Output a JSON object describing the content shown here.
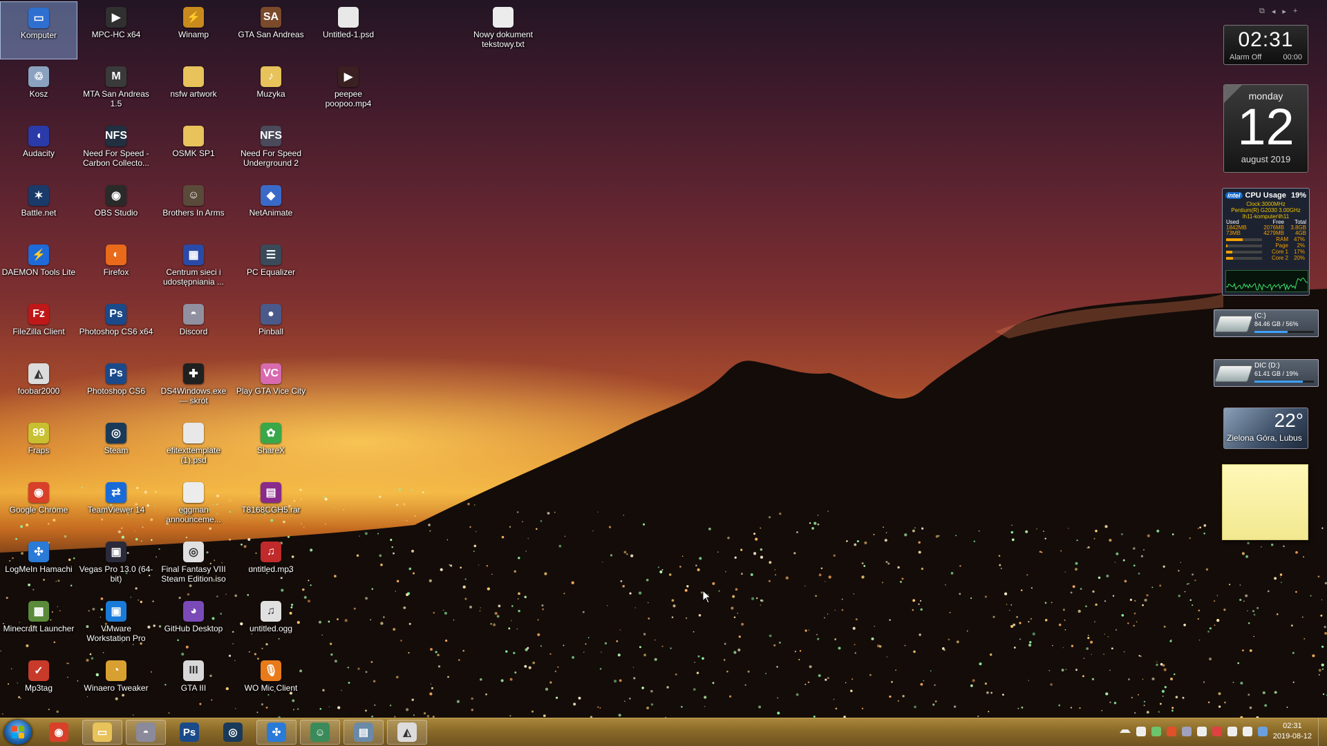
{
  "desktop": {
    "icons": [
      {
        "label": "Komputer",
        "icon": "computer-icon",
        "color": "#2f6fd0",
        "glyph": "▭"
      },
      {
        "label": "MPC-HC x64",
        "icon": "film-clapper-icon",
        "color": "#303030",
        "glyph": "▶"
      },
      {
        "label": "Winamp",
        "icon": "winamp-icon",
        "color": "#c88a1c",
        "glyph": "⚡"
      },
      {
        "label": "GTA San Andreas",
        "icon": "gta-sa-icon",
        "color": "#7a4a2a",
        "glyph": "SA"
      },
      {
        "label": "Untitled-1.psd",
        "icon": "file-icon",
        "color": "#e8e8e8",
        "glyph": ""
      },
      {
        "label": "Nowy dokument tekstowy.txt",
        "icon": "text-file-icon",
        "color": "#ececec",
        "glyph": ""
      },
      {
        "label": "Kosz",
        "icon": "recycle-bin-icon",
        "color": "#8aa2c0",
        "glyph": "♲"
      },
      {
        "label": "MTA San Andreas 1.5",
        "icon": "mta-icon",
        "color": "#3a3a3a",
        "glyph": "M"
      },
      {
        "label": "nsfw artwork",
        "icon": "folder-icon",
        "color": "#e8c25a",
        "glyph": ""
      },
      {
        "label": "Muzyka",
        "icon": "music-folder-icon",
        "color": "#e8c25a",
        "glyph": "♪"
      },
      {
        "label": "peepee poopoo.mp4",
        "icon": "video-file-icon",
        "color": "#3a2020",
        "glyph": "▶"
      },
      {
        "label": "Audacity",
        "icon": "audacity-icon",
        "color": "#2a3aa8",
        "glyph": "◖"
      },
      {
        "label": "Need For Speed - Carbon Collecto...",
        "icon": "nfs-carbon-icon",
        "color": "#203040",
        "glyph": "NFS"
      },
      {
        "label": "OSMK SP1",
        "icon": "folder-icon",
        "color": "#e8c25a",
        "glyph": ""
      },
      {
        "label": "Need For Speed Underground 2",
        "icon": "nfs-ug2-icon",
        "color": "#4a4a5a",
        "glyph": "NFS"
      },
      {
        "label": "Battle.net",
        "icon": "battlenet-icon",
        "color": "#1a3a6a",
        "glyph": "✶"
      },
      {
        "label": "OBS Studio",
        "icon": "obs-icon",
        "color": "#2a2a2a",
        "glyph": "◉"
      },
      {
        "label": "Brothers In Arms",
        "icon": "brothers-in-arms-icon",
        "color": "#5a4a3a",
        "glyph": "☺"
      },
      {
        "label": "NetAnimate",
        "icon": "netanimate-icon",
        "color": "#3a6ac8",
        "glyph": "◆"
      },
      {
        "label": "DAEMON Tools Lite",
        "icon": "daemon-tools-icon",
        "color": "#1e6ad8",
        "glyph": "⚡"
      },
      {
        "label": "Firefox",
        "icon": "firefox-icon",
        "color": "#e86a1a",
        "glyph": "◐"
      },
      {
        "label": "Centrum sieci i udostępniania ...",
        "icon": "network-center-icon",
        "color": "#2a4aa8",
        "glyph": "▦"
      },
      {
        "label": "PC Equalizer",
        "icon": "equalizer-icon",
        "color": "#3a4a5a",
        "glyph": "☰"
      },
      {
        "label": "FileZilla Client",
        "icon": "filezilla-icon",
        "color": "#c01818",
        "glyph": "Fz"
      },
      {
        "label": "Photoshop CS6 x64",
        "icon": "photoshop-icon",
        "color": "#1a4a8a",
        "glyph": "Ps"
      },
      {
        "label": "Discord",
        "icon": "discord-icon",
        "color": "#9090a0",
        "glyph": "◓"
      },
      {
        "label": "Pinball",
        "icon": "pinball-icon",
        "color": "#4a5a8a",
        "glyph": "●"
      },
      {
        "label": "foobar2000",
        "icon": "foobar-icon",
        "color": "#dcdcdc",
        "glyph": "◭"
      },
      {
        "label": "Photoshop CS6",
        "icon": "photoshop-icon",
        "color": "#1a4a8a",
        "glyph": "Ps"
      },
      {
        "label": "DS4Windows.exe — skrót",
        "icon": "gamepad-icon",
        "color": "#202020",
        "glyph": "✚"
      },
      {
        "label": "Play GTA Vice City",
        "icon": "gta-vc-icon",
        "color": "#d86ab0",
        "glyph": "VC"
      },
      {
        "label": "Fraps",
        "icon": "fraps-icon",
        "color": "#c8c030",
        "glyph": "99"
      },
      {
        "label": "Steam",
        "icon": "steam-icon",
        "color": "#1a3a5a",
        "glyph": "◎"
      },
      {
        "label": "efitexttemplate (1).psd",
        "icon": "file-icon",
        "color": "#e8e8e8",
        "glyph": ""
      },
      {
        "label": "ShareX",
        "icon": "sharex-icon",
        "color": "#38a848",
        "glyph": "✿"
      },
      {
        "label": "Google Chrome",
        "icon": "chrome-icon",
        "color": "#d8402a",
        "glyph": "◉"
      },
      {
        "label": "TeamViewer 14",
        "icon": "teamviewer-icon",
        "color": "#1a6ad8",
        "glyph": "⇄"
      },
      {
        "label": "eggman announceme...",
        "icon": "text-file-icon",
        "color": "#ececec",
        "glyph": ""
      },
      {
        "label": "T8168CGH5.rar",
        "icon": "rar-archive-icon",
        "color": "#8a2a8a",
        "glyph": "▤"
      },
      {
        "label": "LogMeIn Hamachi",
        "icon": "hamachi-icon",
        "color": "#2a7ad8",
        "glyph": "✣"
      },
      {
        "label": "Vegas Pro 13.0 (64-bit)",
        "icon": "vegas-icon",
        "color": "#2a2a3a",
        "glyph": "▣"
      },
      {
        "label": "Final Fantasy VIII Steam Edition.iso",
        "icon": "disc-image-icon",
        "color": "#e0e0e0",
        "glyph": "◎"
      },
      {
        "label": "untitled.mp3",
        "icon": "mp3-file-icon",
        "color": "#c02a2a",
        "glyph": "♫"
      },
      {
        "label": "Minecraft Launcher",
        "icon": "minecraft-icon",
        "color": "#5a8a3a",
        "glyph": "▩"
      },
      {
        "label": "VMware Workstation Pro",
        "icon": "vmware-icon",
        "color": "#1a7ad8",
        "glyph": "▣"
      },
      {
        "label": "GitHub Desktop",
        "icon": "github-icon",
        "color": "#7a4ab8",
        "glyph": "◕"
      },
      {
        "label": "untitled.ogg",
        "icon": "ogg-file-icon",
        "color": "#e0e0e0",
        "glyph": "♫"
      },
      {
        "label": "Mp3tag",
        "icon": "mp3tag-icon",
        "color": "#c83a2a",
        "glyph": "✓"
      },
      {
        "label": "Winaero Tweaker",
        "icon": "winaero-icon",
        "color": "#d8a030",
        "glyph": "◔"
      },
      {
        "label": "GTA III",
        "icon": "gta3-icon",
        "color": "#d8d8d8",
        "glyph": "III"
      },
      {
        "label": "WO Mic Client",
        "icon": "microphone-icon",
        "color": "#e87a1a",
        "glyph": "🎙"
      }
    ]
  },
  "gadgets": {
    "clock": {
      "time": "02:31",
      "alarm": "Alarm Off",
      "alarm_time": "00:00"
    },
    "calendar": {
      "weekday": "monday",
      "day": "12",
      "month_year": "august 2019"
    },
    "cpu": {
      "brand": "intel",
      "title": "CPU Usage",
      "percent": "19%",
      "clock": "Clock:3000MHz",
      "model": "Pentium(R) G2030 3.00GHz",
      "host": "lh11-komputer\\lh11",
      "mem_headers": [
        "Used",
        "Free",
        "Total"
      ],
      "mem_rows": [
        [
          "1842MB",
          "2076MB",
          "3.8GB"
        ],
        [
          "73MB",
          "4279MB",
          "4GB"
        ]
      ],
      "bars": [
        {
          "label": "RAM",
          "percent": "47%",
          "value": 0.47
        },
        {
          "label": "Page",
          "percent": "2%",
          "value": 0.02
        },
        {
          "label": "Core 1",
          "percent": "17%",
          "value": 0.17
        },
        {
          "label": "Core 2",
          "percent": "20%",
          "value": 0.2
        }
      ]
    },
    "drives": [
      {
        "name": "(C:)",
        "info": "84.46 GB / 56%",
        "fill": 0.56
      },
      {
        "name": "DIC (D:)",
        "info": "61.41 GB / 19%",
        "fill": 0.81
      }
    ],
    "weather": {
      "temperature": "22°",
      "location": "Zielona Góra, Lubus"
    }
  },
  "taskbar": {
    "items": [
      {
        "name": "chrome",
        "icon": "chrome-icon",
        "color": "#d8402a",
        "glyph": "◉",
        "pinned": false
      },
      {
        "name": "explorer",
        "icon": "folder-icon",
        "color": "#e8c25a",
        "glyph": "▭",
        "pinned": true
      },
      {
        "name": "discord",
        "icon": "discord-icon",
        "color": "#8a8a9a",
        "glyph": "◓",
        "pinned": true
      },
      {
        "name": "photoshop",
        "icon": "photoshop-icon",
        "color": "#1a4a8a",
        "glyph": "Ps",
        "pinned": false
      },
      {
        "name": "steam",
        "icon": "steam-icon",
        "color": "#1a3a5a",
        "glyph": "◎",
        "pinned": false
      },
      {
        "name": "hamachi",
        "icon": "hamachi-icon",
        "color": "#2a7ad8",
        "glyph": "✣",
        "pinned": true
      },
      {
        "name": "users",
        "icon": "users-icon",
        "color": "#3a8a5a",
        "glyph": "☺",
        "pinned": true
      },
      {
        "name": "gadgets",
        "icon": "gadgets-icon",
        "color": "#6a8aa8",
        "glyph": "▤",
        "pinned": true
      },
      {
        "name": "foobar",
        "icon": "foobar-icon",
        "color": "#dcdcdc",
        "glyph": "◭",
        "pinned": true
      }
    ],
    "tray_icons": [
      "show-hidden-icon",
      "network-grid-icon",
      "person-icon",
      "chrome-icon",
      "discord-icon",
      "gamepad-icon",
      "volume-muted-icon",
      "action-center-icon",
      "speaker-icon",
      "keyboard-icon"
    ],
    "tray_colors": [
      "#ddd",
      "#eee",
      "#6cc46c",
      "#e0502a",
      "#a0a0c0",
      "#eee",
      "#e04040",
      "#eee",
      "#eee",
      "#6aa0e0"
    ],
    "clock_time": "02:31",
    "clock_date": "2019-08-12"
  }
}
